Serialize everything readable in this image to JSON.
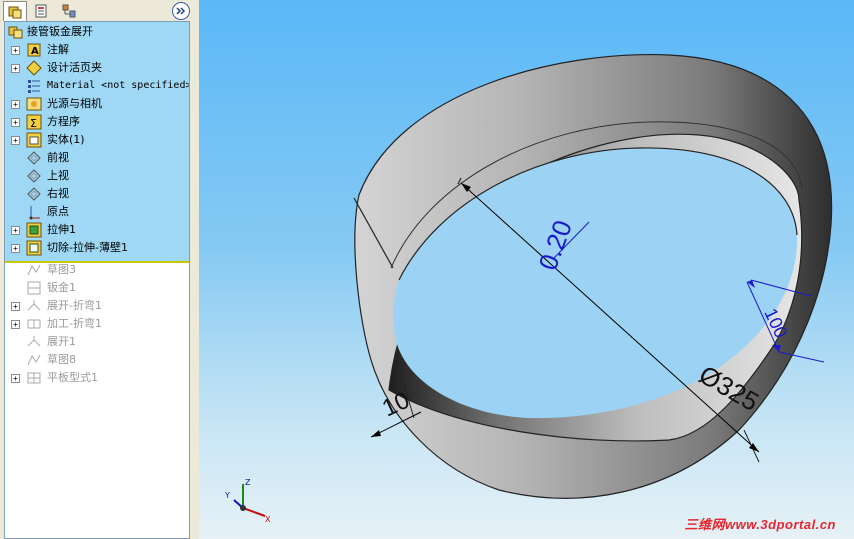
{
  "tabs": [
    {
      "name": "feature-manager"
    },
    {
      "name": "property-manager"
    },
    {
      "name": "configuration-manager"
    }
  ],
  "tree": {
    "root": "接管钣金展开",
    "items": [
      {
        "label": "注解",
        "expandable": true,
        "icon": "annotation-icon",
        "suppressed": false
      },
      {
        "label": "设计活页夹",
        "expandable": true,
        "icon": "design-binder-icon",
        "suppressed": false
      },
      {
        "label": "Material <not specified>",
        "expandable": false,
        "icon": "material-icon",
        "suppressed": false
      },
      {
        "label": "光源与相机",
        "expandable": true,
        "icon": "lights-cameras-icon",
        "suppressed": false
      },
      {
        "label": "方程序",
        "expandable": true,
        "icon": "equations-icon",
        "suppressed": false
      },
      {
        "label": "实体(1)",
        "expandable": true,
        "icon": "solid-bodies-icon",
        "suppressed": false
      },
      {
        "label": "前视",
        "expandable": false,
        "icon": "plane-icon",
        "suppressed": false
      },
      {
        "label": "上视",
        "expandable": false,
        "icon": "plane-icon",
        "suppressed": false
      },
      {
        "label": "右视",
        "expandable": false,
        "icon": "plane-icon",
        "suppressed": false
      },
      {
        "label": "原点",
        "expandable": false,
        "icon": "origin-icon",
        "suppressed": false
      },
      {
        "label": "拉伸1",
        "expandable": true,
        "icon": "extrude-icon",
        "suppressed": false
      },
      {
        "label": "切除-拉伸-薄壁1",
        "expandable": true,
        "icon": "cut-extrude-icon",
        "suppressed": false
      },
      {
        "label": "草图3",
        "expandable": false,
        "icon": "sketch-icon",
        "suppressed": true
      },
      {
        "label": "钣金1",
        "expandable": false,
        "icon": "sheet-metal-icon",
        "suppressed": true
      },
      {
        "label": "展开-折弯1",
        "expandable": true,
        "icon": "unfold-icon",
        "suppressed": true
      },
      {
        "label": "加工-折弯1",
        "expandable": true,
        "icon": "process-bends-icon",
        "suppressed": true
      },
      {
        "label": "展开1",
        "expandable": false,
        "icon": "unfold-icon",
        "suppressed": true
      },
      {
        "label": "草图8",
        "expandable": false,
        "icon": "sketch-icon",
        "suppressed": true
      },
      {
        "label": "平板型式1",
        "expandable": true,
        "icon": "flat-pattern-icon",
        "suppressed": true
      }
    ]
  },
  "viewport": {
    "dimensions": {
      "diameter": "Ø325",
      "thickness": "0.20",
      "height": "100",
      "small": "10"
    },
    "triad": {
      "x": "X",
      "y": "Y",
      "z": "Z"
    },
    "watermark": "三维网www.3dportal.cn"
  },
  "colors": {
    "tree_highlight": "#9ed8f5",
    "rollback_bar": "#c8c800",
    "dimension_blue": "#1a1acc"
  }
}
